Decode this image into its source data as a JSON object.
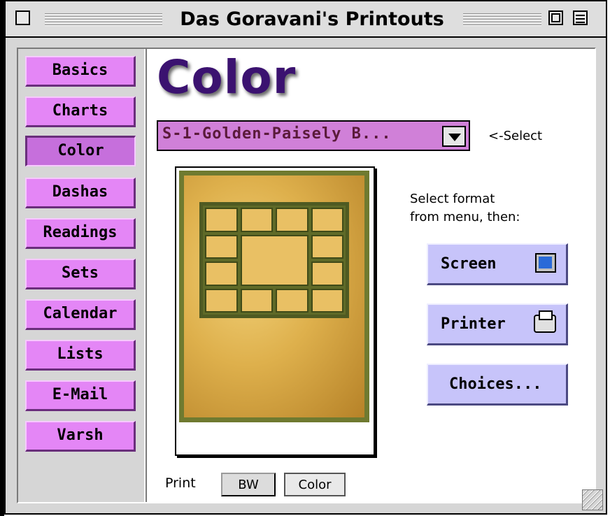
{
  "window": {
    "title": "Das Goravani's Printouts"
  },
  "nav": {
    "items": [
      {
        "label": "Basics"
      },
      {
        "label": "Charts"
      },
      {
        "label": "Color",
        "selected": true
      },
      {
        "label": "Dashas"
      },
      {
        "label": "Readings"
      },
      {
        "label": "Sets"
      },
      {
        "label": "Calendar"
      },
      {
        "label": "Lists"
      },
      {
        "label": "E-Mail"
      },
      {
        "label": "Varsh"
      }
    ]
  },
  "main": {
    "page_title": "Color",
    "style_select": {
      "value": "S-1-Golden-Paisely B...",
      "hint": "<-Select"
    },
    "format_hint_line1": "Select format",
    "format_hint_line2": "from menu, then:",
    "buttons": {
      "screen": "Screen",
      "printer": "Printer",
      "choices": "Choices..."
    },
    "print_mode": {
      "label": "Print",
      "bw": "BW",
      "color": "Color"
    }
  },
  "icons": {
    "screen": "monitor-icon",
    "printer": "printer-icon"
  },
  "colors": {
    "nav_button": "#e486f6",
    "nav_selected": "#c66fdc",
    "action_button": "#c7c4fa",
    "title_purple": "#3b1270",
    "dropdown_bg": "#d080d8"
  }
}
